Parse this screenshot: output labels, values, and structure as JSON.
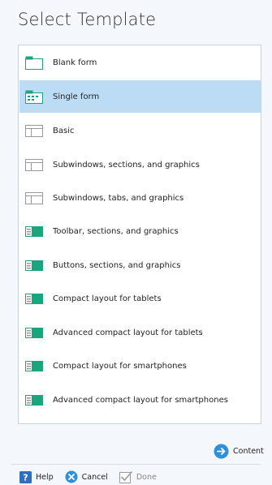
{
  "title": "Select Template",
  "templates": [
    {
      "label": "Blank form",
      "icon": "blank-form-icon",
      "selected": false
    },
    {
      "label": "Single form",
      "icon": "single-form-icon",
      "selected": true
    },
    {
      "label": "Basic",
      "icon": "basic-layout-icon",
      "selected": false
    },
    {
      "label": "Subwindows, sections, and graphics",
      "icon": "subwindows-icon",
      "selected": false
    },
    {
      "label": "Subwindows, tabs, and graphics",
      "icon": "subwindows-icon",
      "selected": false
    },
    {
      "label": "Toolbar, sections, and graphics",
      "icon": "toolbar-layout-icon",
      "selected": false
    },
    {
      "label": "Buttons, sections, and graphics",
      "icon": "buttons-layout-icon",
      "selected": false
    },
    {
      "label": "Compact layout for tablets",
      "icon": "compact-layout-icon",
      "selected": false
    },
    {
      "label": "Advanced compact layout for tablets",
      "icon": "compact-layout-icon",
      "selected": false
    },
    {
      "label": "Compact layout for smartphones",
      "icon": "compact-layout-icon",
      "selected": false
    },
    {
      "label": "Advanced compact layout for smartphones",
      "icon": "compact-layout-icon",
      "selected": false
    }
  ],
  "actions": {
    "content_label": "Content",
    "help_label": "Help",
    "cancel_label": "Cancel",
    "done_label": "Done"
  },
  "colors": {
    "accent": "#2f8fd8",
    "selection": "#bcdcf6",
    "teal": "#1aa57e"
  }
}
